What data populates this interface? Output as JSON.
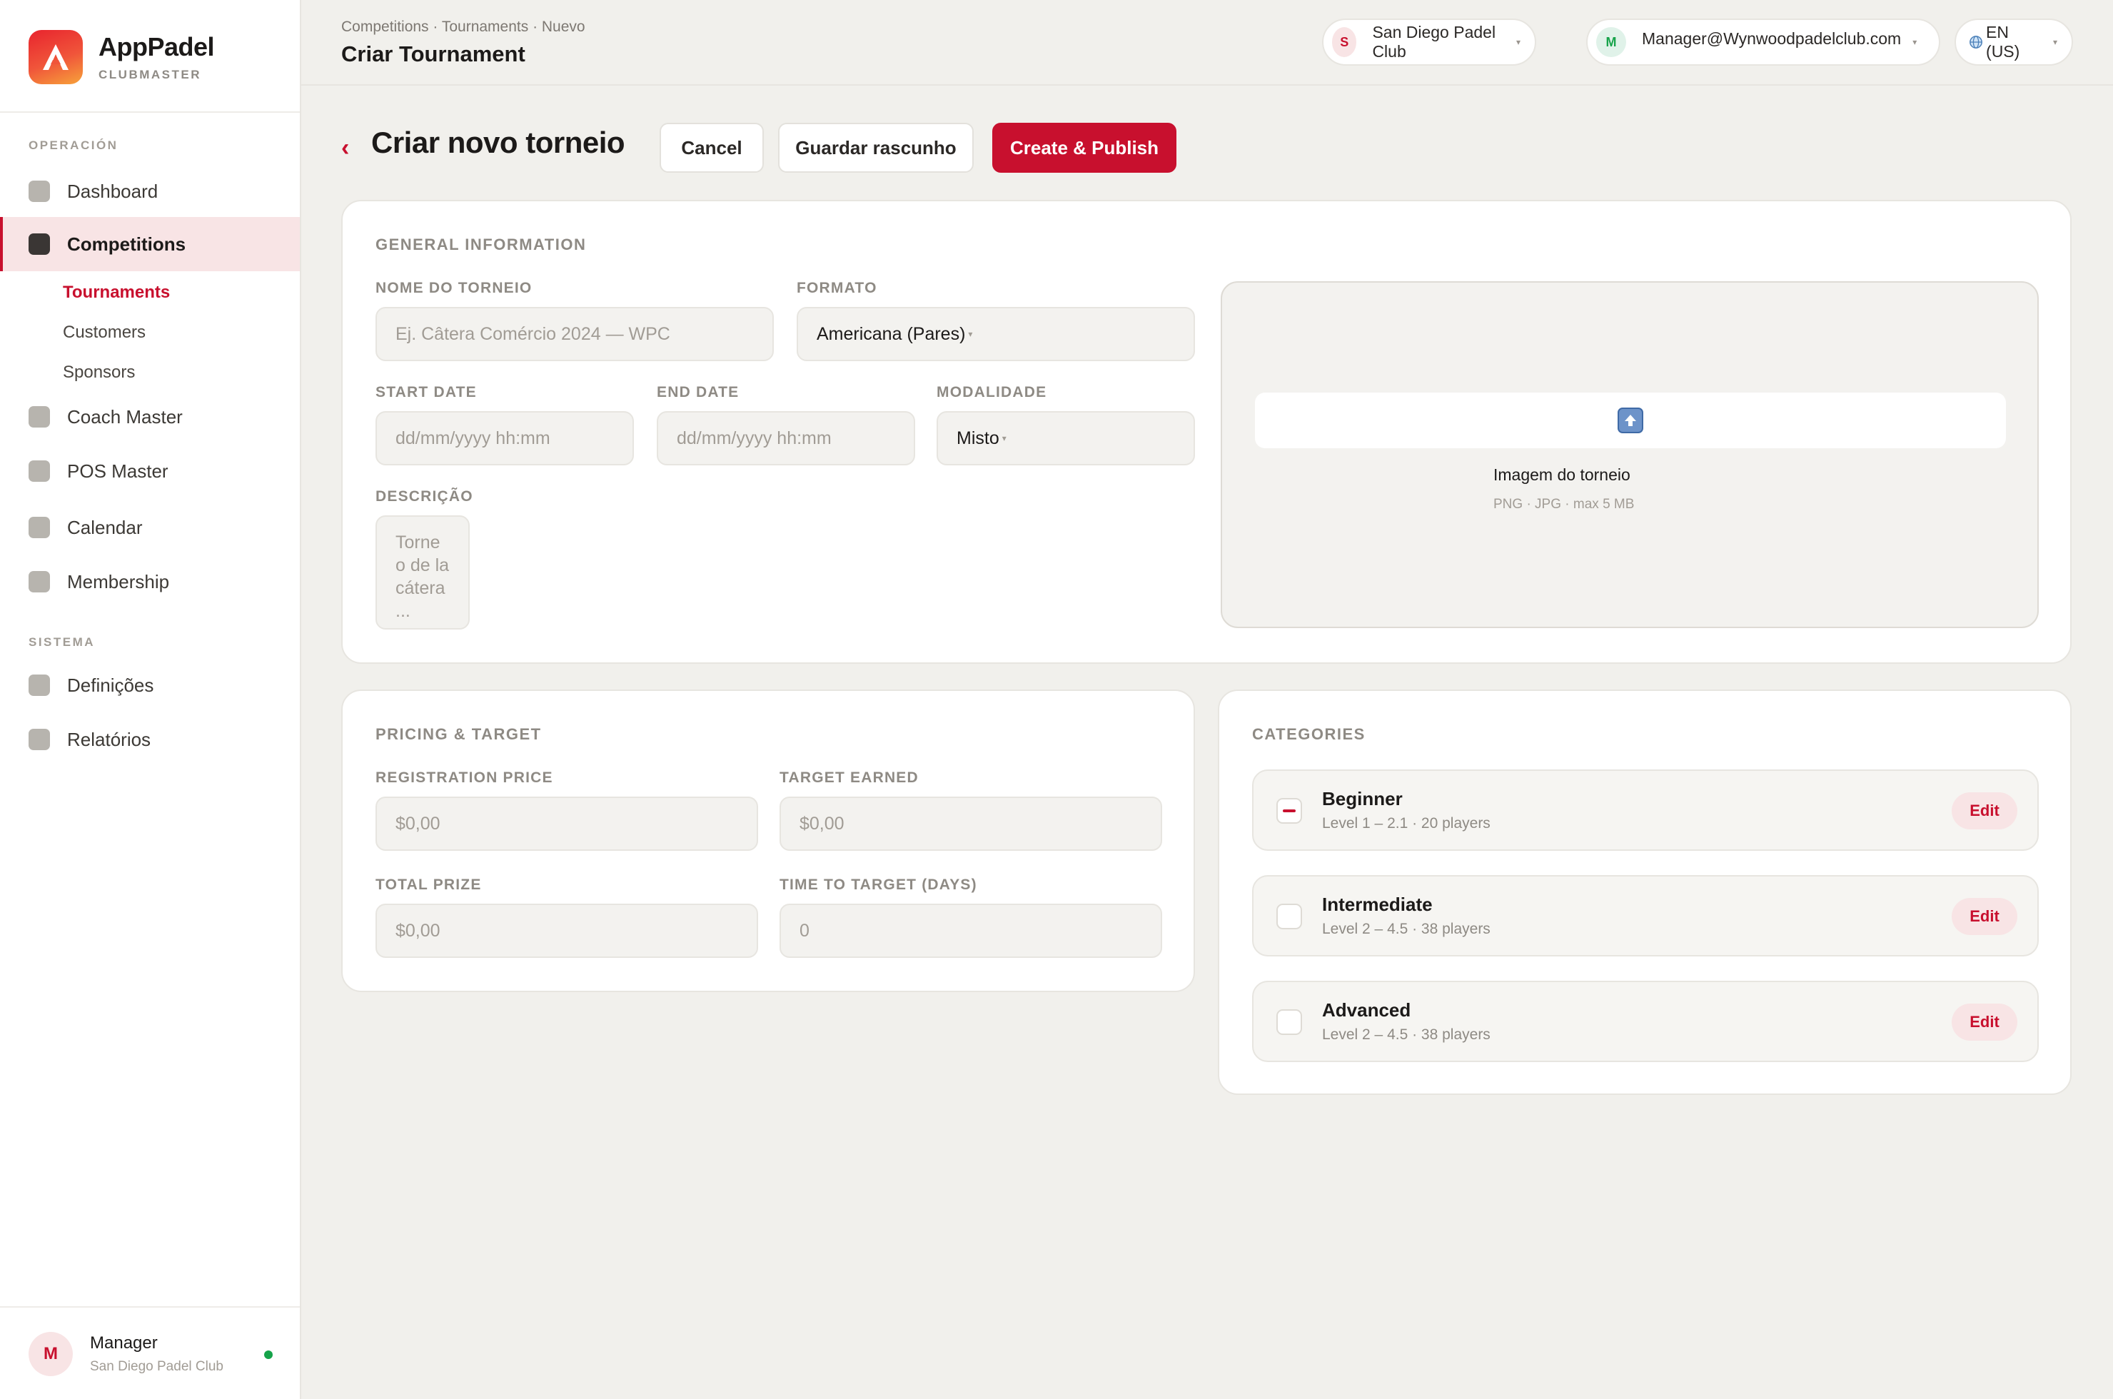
{
  "brand": {
    "name": "AppPadel",
    "subtitle": "CLUBMASTER"
  },
  "sidebar": {
    "section_operacion": "OPERACIÓN",
    "section_sistema": "SISTEMA",
    "items": {
      "dashboard": "Dashboard",
      "competitions": "Competitions",
      "coach_master": "Coach Master",
      "pos_master": "POS Master",
      "calendar": "Calendar",
      "membership": "Membership",
      "definicoes": "Definições",
      "relatorios": "Relatórios"
    },
    "sub_items": {
      "tournaments": "Tournaments",
      "customers": "Customers",
      "sponsors": "Sponsors"
    },
    "user": {
      "initial": "M",
      "name": "Manager",
      "club": "San Diego Padel Club"
    }
  },
  "header": {
    "breadcrumb": "Competitions · Tournaments · Nuevo",
    "title": "Criar Tournament",
    "club": {
      "initial": "S",
      "name": "San Diego Padel Club"
    },
    "account": {
      "initial": "M",
      "email": "Manager@Wynwoodpadelclub.com"
    },
    "language": "EN (US)",
    "dropdown_glyph": "▾"
  },
  "page": {
    "back_glyph": "‹",
    "heading": "Criar novo torneio",
    "cancel_label": "Cancel",
    "draft_label": "Guardar rascunho",
    "publish_label": "Create & Publish"
  },
  "general": {
    "title": "GENERAL INFORMATION",
    "name_label": "NOME DO TORNEIO",
    "name_placeholder": "Ej. Câtera Comércio 2024 — WPC",
    "format_label": "FORMATO",
    "format_value": "Americana (Pares)",
    "start_label": "START DATE",
    "start_placeholder": "dd/mm/yyyy hh:mm",
    "end_label": "END DATE",
    "end_placeholder": "dd/mm/yyyy hh:mm",
    "modality_label": "MODALIDADE",
    "modality_value": "Misto",
    "description_label": "DESCRIÇÃO",
    "description_placeholder": "Torneo de la cátera ...",
    "image_title": "Imagem do torneio",
    "image_hint": "PNG · JPG · max 5 MB"
  },
  "pricing": {
    "title": "PRICING & TARGET",
    "registration_label": "REGISTRATION PRICE",
    "registration_value": "$0,00",
    "target_label": "TARGET EARNED",
    "target_value": "$0,00",
    "prize_label": "TOTAL PRIZE",
    "prize_value": "$0,00",
    "days_label": "TIME TO TARGET (DAYS)",
    "days_value": "0"
  },
  "categories": {
    "title": "CATEGORIES",
    "edit_label": "Edit",
    "items": [
      {
        "name": "Beginner",
        "meta": "Level 1 – 2.1 · 20 players",
        "selected": true
      },
      {
        "name": "Intermediate",
        "meta": "Level 2 – 4.5 · 38 players",
        "selected": false
      },
      {
        "name": "Advanced",
        "meta": "Level 2 – 4.5 · 38 players",
        "selected": false
      }
    ]
  },
  "colors": {
    "accent": "#c8102e",
    "background": "#f1f0ec",
    "card": "#ffffff",
    "online": "#16a34a"
  }
}
